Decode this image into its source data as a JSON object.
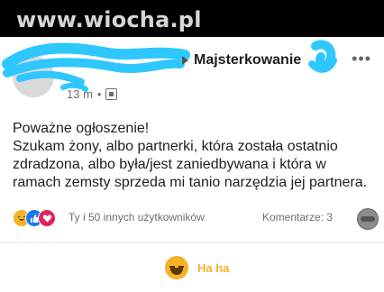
{
  "watermark": "www.wiocha.pl",
  "post": {
    "group_name": "Majsterkowanie",
    "time": "13 m",
    "separator": "•",
    "more": "•••",
    "text_lines": [
      "Poważne ogłoszenie!",
      "Szukam żony, albo partnerki, która została ostatnio",
      "zdradzona, albo była/jest zaniedbywana i która w",
      "ramach zemsty sprzeda mi tanio narzędzia jej partnera."
    ]
  },
  "reactions": {
    "icons": [
      "haha-icon",
      "like-icon",
      "love-icon"
    ],
    "summary": "Ty i 50 innych użytkowników",
    "comments": "Komentarze: 3"
  },
  "action": {
    "label": "Ha ha",
    "color": "#f7b125"
  },
  "colors": {
    "redaction": "#2ec7ff",
    "like": "#1877f2",
    "love": "#e0245e"
  }
}
